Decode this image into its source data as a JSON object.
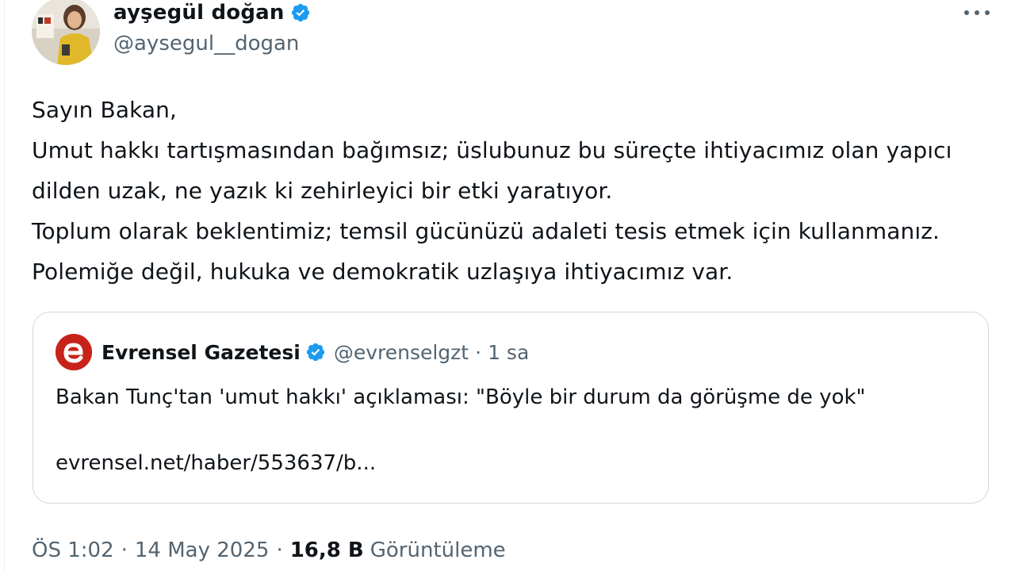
{
  "author": {
    "display_name": "ayşegül doğan",
    "handle": "@aysegul__dogan",
    "verified_icon": "verified-badge-icon",
    "avatar_icon": "profile-photo"
  },
  "tweet": {
    "text": "Sayın Bakan,\nUmut hakkı tartışmasından bağımsız; üslubunuz bu süreçte ihtiyacımız olan yapıcı dilden uzak, ne yazık ki zehirleyici bir etki yaratıyor.\nToplum olarak beklentimiz; temsil gücünüzü adaleti tesis etmek için kullanmanız. Polemiğe değil, hukuka ve demokratik uzlaşıya ihtiyacımız var."
  },
  "quoted_tweet": {
    "name": "Evrensel Gazetesi",
    "handle": "@evrenselgzt",
    "separator": "·",
    "time": "1 sa",
    "logo_letter": "e",
    "text": "Bakan Tunç'tan 'umut hakkı' açıklaması: \"Böyle bir durum da görüşme de yok\"",
    "link": "evrensel.net/haber/553637/b..."
  },
  "meta": {
    "time": "ÖS 1:02",
    "separator": "·",
    "date": "14 May 2025",
    "views_count": "16,8 B",
    "views_label": "Görüntüleme"
  },
  "colors": {
    "verified_blue": "#1d9bf0",
    "evrensel_red": "#c8231a",
    "secondary_text": "#536471",
    "border": "#cfd9de"
  }
}
